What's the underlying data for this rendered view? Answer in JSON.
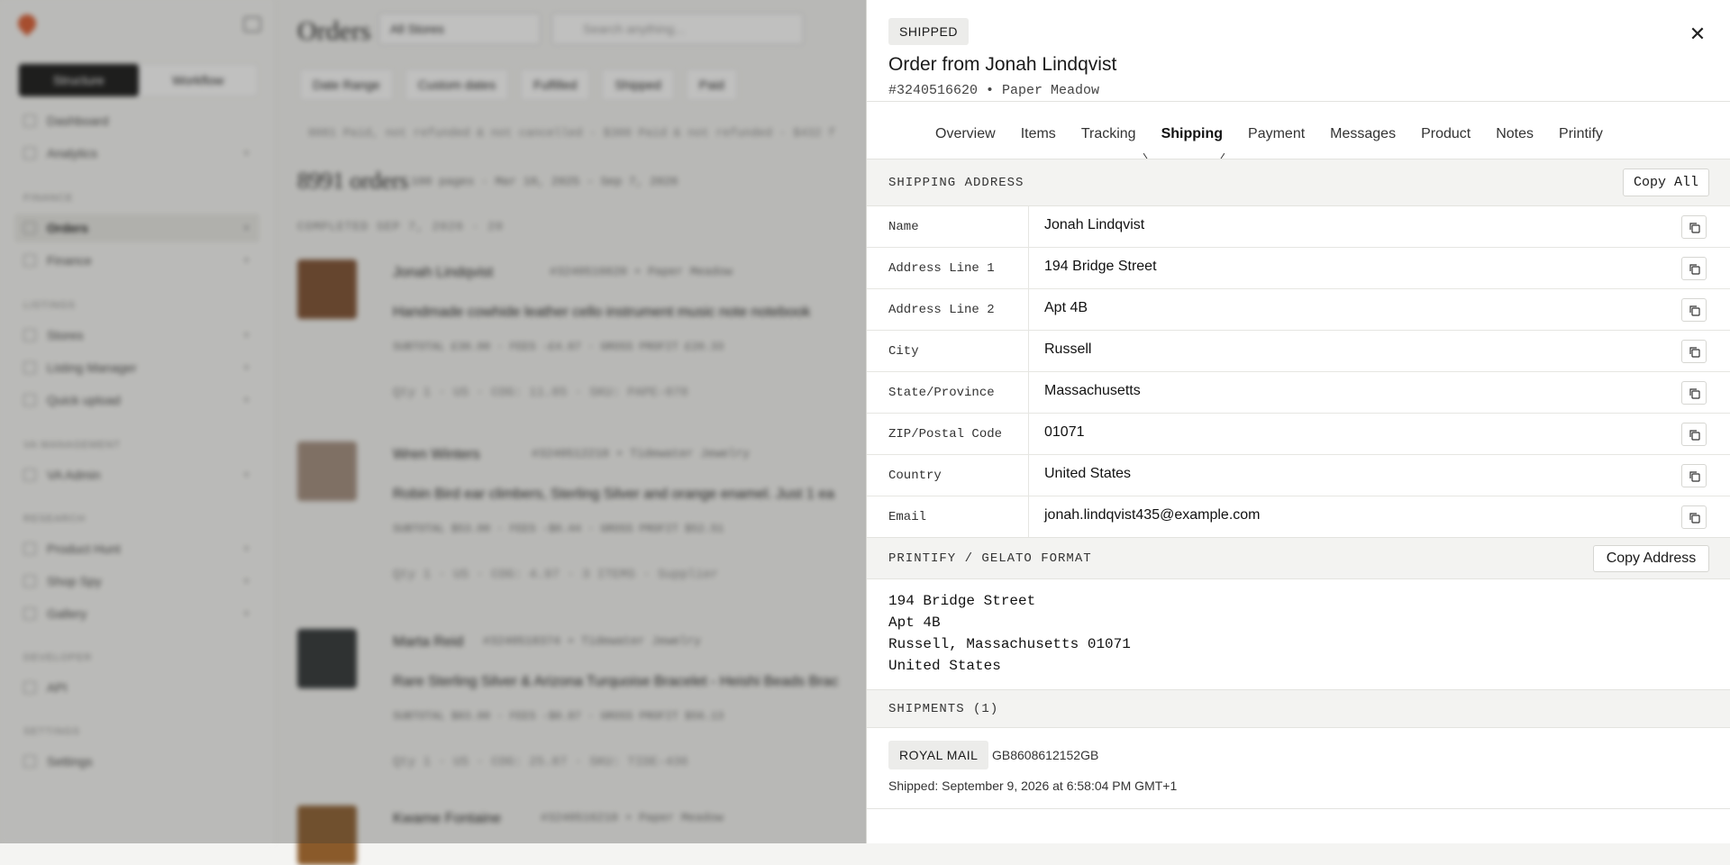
{
  "app": {
    "page_title": "Orders",
    "store_select": "All Stores",
    "search_placeholder": "Search anything...",
    "sidebar": {
      "segment": [
        "Structure",
        "Workflow"
      ],
      "top_items": [
        "Dashboard",
        "Analytics"
      ],
      "groups": [
        {
          "label": "Finance",
          "items": [
            "Orders",
            "Finance"
          ]
        },
        {
          "label": "Listings",
          "items": [
            "Stores",
            "Listing Manager",
            "Quick upload"
          ]
        },
        {
          "label": "VA Management",
          "items": [
            "VA Admin"
          ]
        },
        {
          "label": "Research",
          "items": [
            "Product Hunt",
            "Shop Spy",
            "Gallery"
          ]
        },
        {
          "label": "Developer",
          "items": [
            "API"
          ]
        },
        {
          "label": "Settings",
          "items": [
            "Settings"
          ]
        }
      ]
    },
    "filters": [
      "Date Range",
      "Custom dates",
      "Fulfilled",
      "Shipped",
      "Paid"
    ],
    "summary": "8081 Paid, not refunded & not cancelled · $300 Paid & not refunded · $432 f",
    "orders_count": "8991 orders",
    "orders_range": "100 pages · Mar 10, 2025 - Sep 7, 2026",
    "group_label": "COMPLETED SEP 7, 2026 · 20",
    "orders": [
      {
        "customer": "Jonah Lindqvist",
        "meta": "#3240516620 • Paper Meadow",
        "product": "Handmade cowhide leather cello instrument music note notebook",
        "stats": "SUBTOTAL £30.00 · FEES -£4.67 · GROSS PROFIT £20.33",
        "qty": "Qty 1 · US · COG: 11.85 · SKU: PAPE-078"
      },
      {
        "customer": "Wren Winters",
        "meta": "#3240512210 • Tidewater Jewelry",
        "product": "Robin Bird ear climbers, Sterling Silver and orange enamel. Just 1 ea",
        "stats": "SUBTOTAL $53.00 · FEES -$0.44 · GROSS PROFIT $52.51",
        "qty": "Qty 1 · US · COG: 4.97 · 3 ITEMS · Supplier"
      },
      {
        "customer": "Marta Reid",
        "meta": "#3240518374 • Tidewater Jewelry",
        "product": "Rare Sterling Silver & Arizona Turquoise Bracelet - Heishi Beads Brac",
        "stats": "SUBTOTAL $83.00 · FEES -$0.87 · GROSS PROFIT $56.13",
        "qty": "Qty 1 · US · COG: 25.87 · SKU: TIDE-436"
      },
      {
        "customer": "Kwame Fontaine",
        "meta": "#3240516210 • Paper Meadow",
        "product": "",
        "stats": "",
        "qty": ""
      }
    ]
  },
  "drawer": {
    "status": "SHIPPED",
    "title": "Order from Jonah Lindqvist",
    "subtitle": "#3240516620 • Paper Meadow",
    "tabs": [
      "Overview",
      "Items",
      "Tracking",
      "Shipping",
      "Payment",
      "Messages",
      "Product",
      "Notes",
      "Printify"
    ],
    "active_tab": "Shipping",
    "shipping_address": {
      "heading": "SHIPPING ADDRESS",
      "copy_all": "Copy All",
      "fields": [
        {
          "key": "Name",
          "value": "Jonah Lindqvist"
        },
        {
          "key": "Address Line 1",
          "value": "194 Bridge Street"
        },
        {
          "key": "Address Line 2",
          "value": "Apt 4B"
        },
        {
          "key": "City",
          "value": "Russell"
        },
        {
          "key": "State/Province",
          "value": "Massachusetts"
        },
        {
          "key": "ZIP/Postal Code",
          "value": "01071"
        },
        {
          "key": "Country",
          "value": "United States"
        },
        {
          "key": "Email",
          "value": "jonah.lindqvist435@example.com"
        }
      ]
    },
    "format": {
      "heading": "PRINTIFY / GELATO FORMAT",
      "copy_button": "Copy Address",
      "lines": [
        "194 Bridge Street",
        "Apt 4B",
        "Russell, Massachusetts 01071",
        "United States"
      ]
    },
    "shipments": {
      "heading": "SHIPMENTS (1)",
      "carrier": "ROYAL MAIL",
      "tracking": "GB8608612152GB",
      "shipped_at": "Shipped: September 9, 2026 at 6:58:04 PM GMT+1"
    }
  }
}
